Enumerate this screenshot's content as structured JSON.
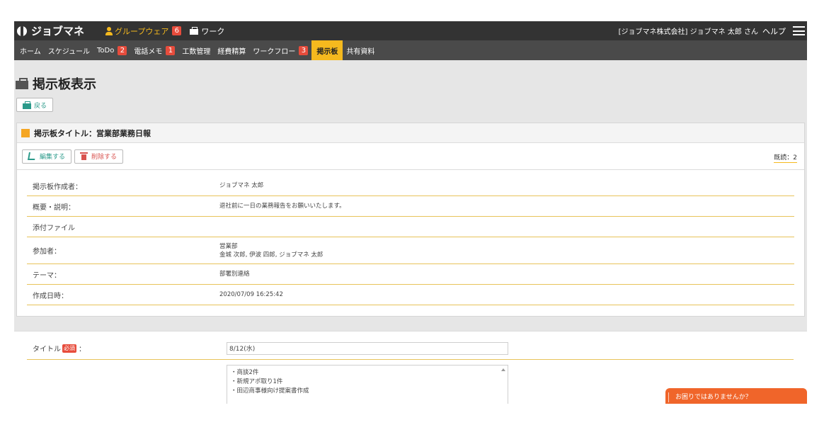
{
  "header": {
    "logo": "ジョブマネ",
    "groupware_label": "グループウェア",
    "groupware_badge": "6",
    "work_label": "ワーク",
    "company_user": "[ジョブマネ株式会社] ジョブマネ 太郎 さん",
    "help": "ヘルプ"
  },
  "nav": {
    "items": [
      {
        "label": "ホーム"
      },
      {
        "label": "スケジュール"
      },
      {
        "label": "ToDo",
        "badge": "2"
      },
      {
        "label": "電話メモ",
        "badge": "1"
      },
      {
        "label": "工数管理"
      },
      {
        "label": "経費精算"
      },
      {
        "label": "ワークフロー",
        "badge": "3"
      },
      {
        "label": "掲示板",
        "active": true
      },
      {
        "label": "共有資料"
      }
    ]
  },
  "page": {
    "title": "掲示板表示",
    "back_label": "戻る"
  },
  "panel": {
    "heading": "掲示板タイトル：営業部業務日報",
    "edit_label": "編集する",
    "delete_label": "削除する",
    "read_count": "既読：2",
    "rows": [
      {
        "label": "掲示板作成者：",
        "value": "ジョブマネ 太郎"
      },
      {
        "label": "概要・説明：",
        "value": "退社前に一日の業務報告をお願いいたします。"
      },
      {
        "label": "添付ファイル",
        "value": ""
      },
      {
        "label": "参加者：",
        "value": "営業部",
        "value2": "金城 次郎, 伊波 四郎, ジョブマネ 太郎"
      },
      {
        "label": "テーマ：",
        "value": "部署別連絡"
      },
      {
        "label": "作成日時：",
        "value": "2020/07/09 16:25:42"
      }
    ]
  },
  "form": {
    "title_label": "タイトル",
    "required": "必須",
    "colon": "：",
    "title_value": "8/12(水)",
    "body_lines": [
      "・商談2件",
      "・新規アポ取り1件",
      "・田辺商事様向け提案書作成"
    ]
  },
  "help_tab": "お困りではありませんか？",
  "colors": {
    "accent": "#f5b91e",
    "badge": "#e74c3c",
    "teal": "#2a9a8a",
    "help": "#f0652a"
  }
}
